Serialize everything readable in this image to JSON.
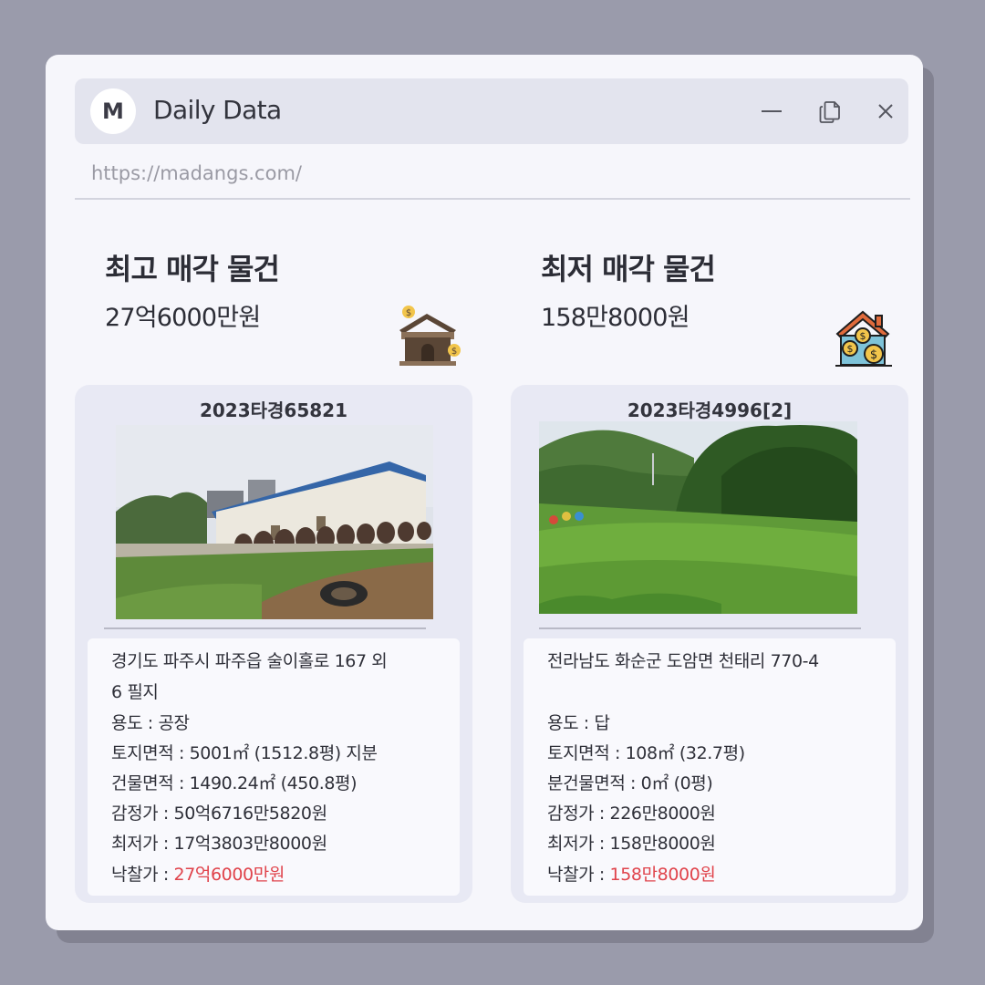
{
  "app": {
    "logo_letter": "M",
    "title": "Daily Data",
    "url": "https://madangs.com/"
  },
  "window_controls": [
    "minimize-icon",
    "copy-icon",
    "close-icon"
  ],
  "highest": {
    "heading": "최고 매각 물건",
    "price": "27억6000만원",
    "icon": "house-dollar-icon",
    "case_number": "2023타경65821",
    "address_line1": "경기도 파주시 파주읍 술이홀로 167 외",
    "address_line2": "6 필지",
    "usage": "용도 : 공장",
    "land_area": "토지면적 : 5001㎡ (1512.8평) 지분",
    "building_area": "건물면적 : 1490.24㎡ (450.8평)",
    "appraisal": "감정가 : 50억6716만5820원",
    "minimum": "최저가 : 17억3803만8000원",
    "winning_label": "낙찰가 : ",
    "winning_value": "27억6000만원"
  },
  "lowest": {
    "heading": "최저 매각 물건",
    "price": "158만8000원",
    "icon": "house-coins-icon",
    "case_number": "2023타경4996[2]",
    "address_line1": "전라남도 화순군 도암면 천태리 770-4",
    "usage": "용도 : 답",
    "land_area": "토지면적 : 108㎡ (32.7평)",
    "building_area": "분건물면적 : 0㎡ (0평)",
    "appraisal": "감정가 : 226만8000원",
    "minimum": "최저가 : 158만8000원",
    "winning_label": "낙찰가 : ",
    "winning_value": "158만8000원"
  },
  "colors": {
    "background": "#9a9bab",
    "window": "#f6f6fb",
    "titlebar": "#e3e4ee",
    "card": "#e8e9f4",
    "highlight_red": "#e0434b"
  }
}
